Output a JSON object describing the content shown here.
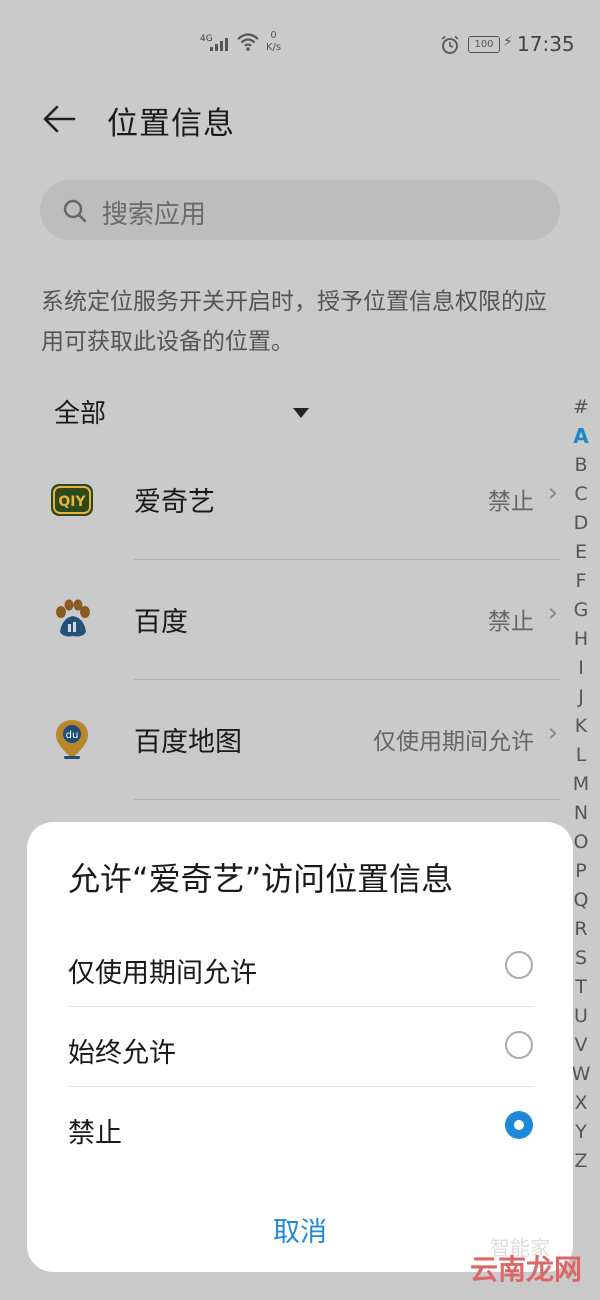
{
  "status_bar": {
    "network": "4G",
    "speed_value": "0",
    "speed_unit": "K/s",
    "battery": "100",
    "time": "17:35"
  },
  "header": {
    "title": "位置信息"
  },
  "search": {
    "placeholder": "搜索应用"
  },
  "description": "系统定位服务开关开启时，授予位置信息权限的应用可获取此设备的位置。",
  "filter": {
    "selected": "全部"
  },
  "alphabet": [
    "#",
    "A",
    "B",
    "C",
    "D",
    "E",
    "F",
    "G",
    "H",
    "I",
    "J",
    "K",
    "L",
    "M",
    "N",
    "O",
    "P",
    "Q",
    "R",
    "S",
    "T",
    "U",
    "V",
    "W",
    "X",
    "Y",
    "Z"
  ],
  "alphabet_active": "A",
  "apps": [
    {
      "name": "爱奇艺",
      "status": "禁止",
      "icon": "iqiyi-icon"
    },
    {
      "name": "百度",
      "status": "禁止",
      "icon": "baidu-paw-icon"
    },
    {
      "name": "百度地图",
      "status": "仅使用期间允许",
      "icon": "baidu-map-pin-icon"
    }
  ],
  "dialog": {
    "title": "允许“爱奇艺”访问位置信息",
    "options": [
      {
        "label": "仅使用期间允许",
        "selected": false
      },
      {
        "label": "始终允许",
        "selected": false
      },
      {
        "label": "禁止",
        "selected": true
      }
    ],
    "cancel": "取消"
  },
  "watermark": {
    "text": "云南龙网",
    "sub": "智能家"
  },
  "colors": {
    "accent": "#1f88d9",
    "overlay": "#cacaca"
  }
}
